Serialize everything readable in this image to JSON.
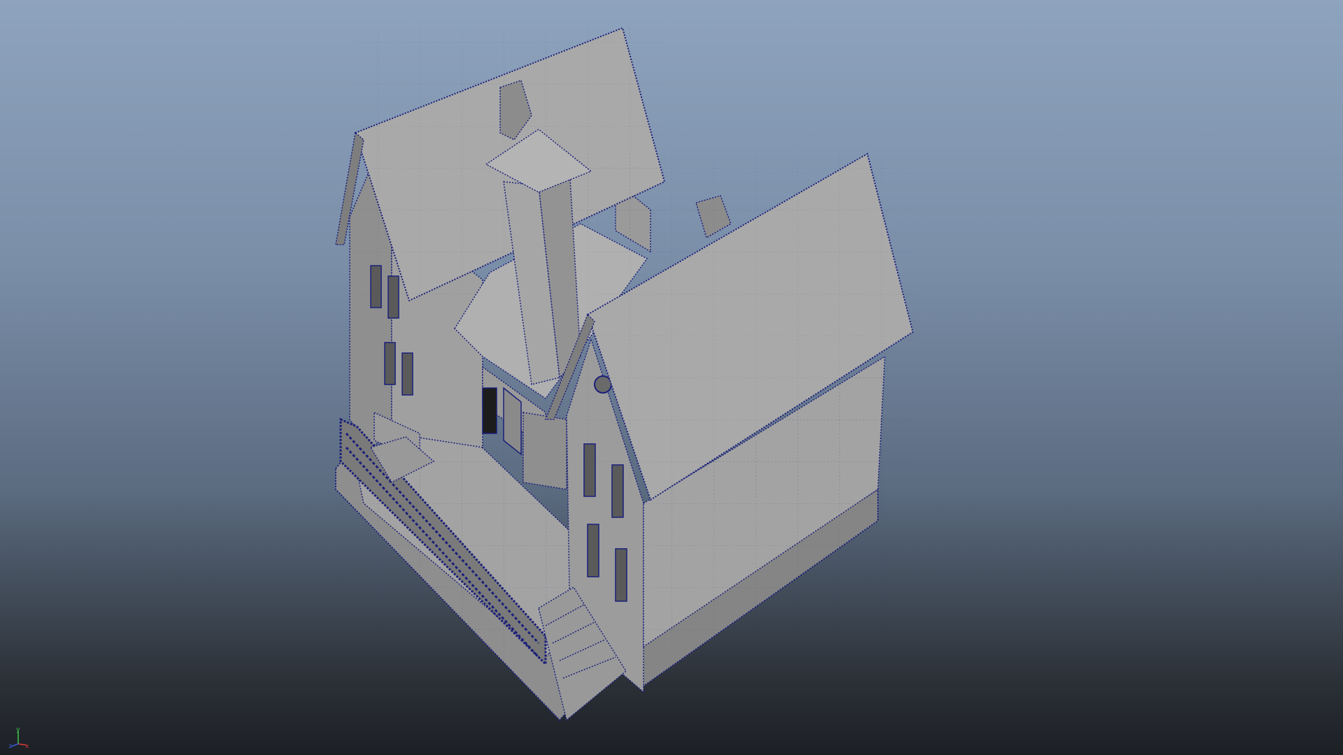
{
  "viewport": {
    "background_top": "#8ea3bd",
    "background_bottom": "#1c1f24",
    "wire_color": "#1a1f7a",
    "surface_color": "#9a9a9a"
  },
  "axis_gizmo": {
    "y_label": "y",
    "x_label": "x",
    "z_label": "z",
    "y_color": "#3cc84a",
    "x_color": "#d93a3a",
    "z_color": "#3a5ad9"
  }
}
